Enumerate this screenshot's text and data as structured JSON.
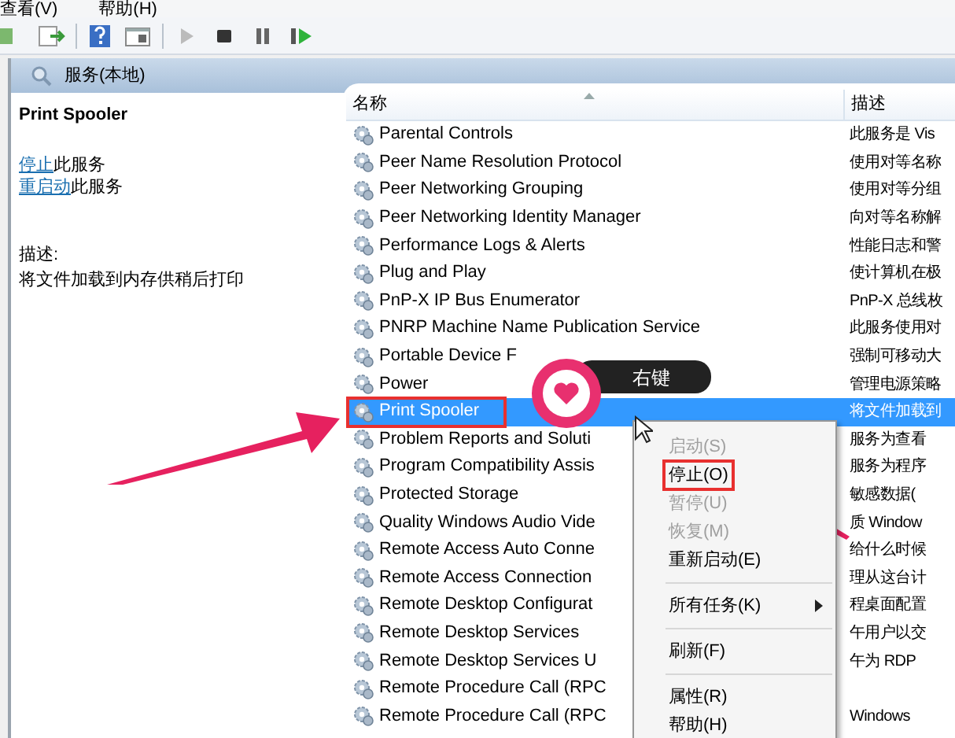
{
  "menu_bar": [
    "查看(V)",
    "帮助(H)"
  ],
  "scope": {
    "title": "服务(本地)"
  },
  "detail": {
    "title": "Print Spooler",
    "actions": [
      {
        "link": "停止",
        "text": "此服务"
      },
      {
        "link": "重启动",
        "text": "此服务"
      }
    ],
    "description_label": "描述:",
    "description": "将文件加载到内存供稍后打印"
  },
  "table": {
    "columns": [
      "名称",
      "描述"
    ],
    "rows": [
      {
        "name": "Parental Controls",
        "description": "此服务是 Vis",
        "selected": false
      },
      {
        "name": "Peer Name Resolution Protocol",
        "description": "使用对等名称",
        "selected": false
      },
      {
        "name": "Peer Networking Grouping",
        "description": "使用对等分组",
        "selected": false
      },
      {
        "name": "Peer Networking Identity Manager",
        "description": "向对等名称解",
        "selected": false
      },
      {
        "name": "Performance Logs & Alerts",
        "description": "性能日志和警",
        "selected": false
      },
      {
        "name": "Plug and Play",
        "description": "使计算机在极",
        "selected": false
      },
      {
        "name": "PnP-X IP Bus Enumerator",
        "description": "PnP-X 总线枚",
        "selected": false
      },
      {
        "name": "PNRP Machine Name Publication Service",
        "description": "此服务使用对",
        "selected": false
      },
      {
        "name": "Portable Device F",
        "description": "强制可移动大",
        "selected": false
      },
      {
        "name": "Power",
        "description": "管理电源策略",
        "selected": false
      },
      {
        "name": "Print Spooler",
        "description": "将文件加载到",
        "selected": true
      },
      {
        "name": "Problem Reports and Soluti",
        "description": "服务为查看",
        "selected": false
      },
      {
        "name": "Program Compatibility Assis",
        "description": "服务为程序",
        "selected": false
      },
      {
        "name": "Protected Storage",
        "description": "敏感数据(",
        "selected": false
      },
      {
        "name": "Quality Windows Audio Vide",
        "description": "质 Window",
        "selected": false
      },
      {
        "name": "Remote Access Auto Conne",
        "description": "给什么时候",
        "selected": false
      },
      {
        "name": "Remote Access Connection",
        "description": "理从这台计",
        "selected": false
      },
      {
        "name": "Remote Desktop Configurat",
        "description": "程桌面配置",
        "selected": false
      },
      {
        "name": "Remote Desktop Services",
        "description": "午用户以交",
        "selected": false
      },
      {
        "name": "Remote Desktop Services U",
        "description": "午为 RDP",
        "selected": false
      },
      {
        "name": "Remote Procedure Call (RPC",
        "selected": false
      },
      {
        "name": "Remote Procedure Call (RPC",
        "description": "Windows",
        "selected": false
      }
    ]
  },
  "context_menu": [
    {
      "kind": "item",
      "label": "启动(S)",
      "disabled": true,
      "highlighted": false
    },
    {
      "kind": "item",
      "label": "停止(O)",
      "disabled": false,
      "highlighted": true
    },
    {
      "kind": "item",
      "label": "暂停(U)",
      "disabled": true,
      "highlighted": false
    },
    {
      "kind": "item",
      "label": "恢复(M)",
      "disabled": true,
      "highlighted": false
    },
    {
      "kind": "item",
      "label": "重新启动(E)",
      "disabled": false,
      "highlighted": false
    },
    {
      "kind": "separator"
    },
    {
      "kind": "submenu",
      "label": "所有任务(K)",
      "disabled": false,
      "highlighted": false
    },
    {
      "kind": "separator"
    },
    {
      "kind": "item",
      "label": "刷新(F)",
      "disabled": false,
      "highlighted": false
    },
    {
      "kind": "separator"
    },
    {
      "kind": "item",
      "label": "属性(R)",
      "disabled": false,
      "highlighted": false
    },
    {
      "kind": "item",
      "label": "帮助(H)",
      "disabled": false,
      "highlighted": false
    }
  ],
  "callout": {
    "text": "右键"
  }
}
